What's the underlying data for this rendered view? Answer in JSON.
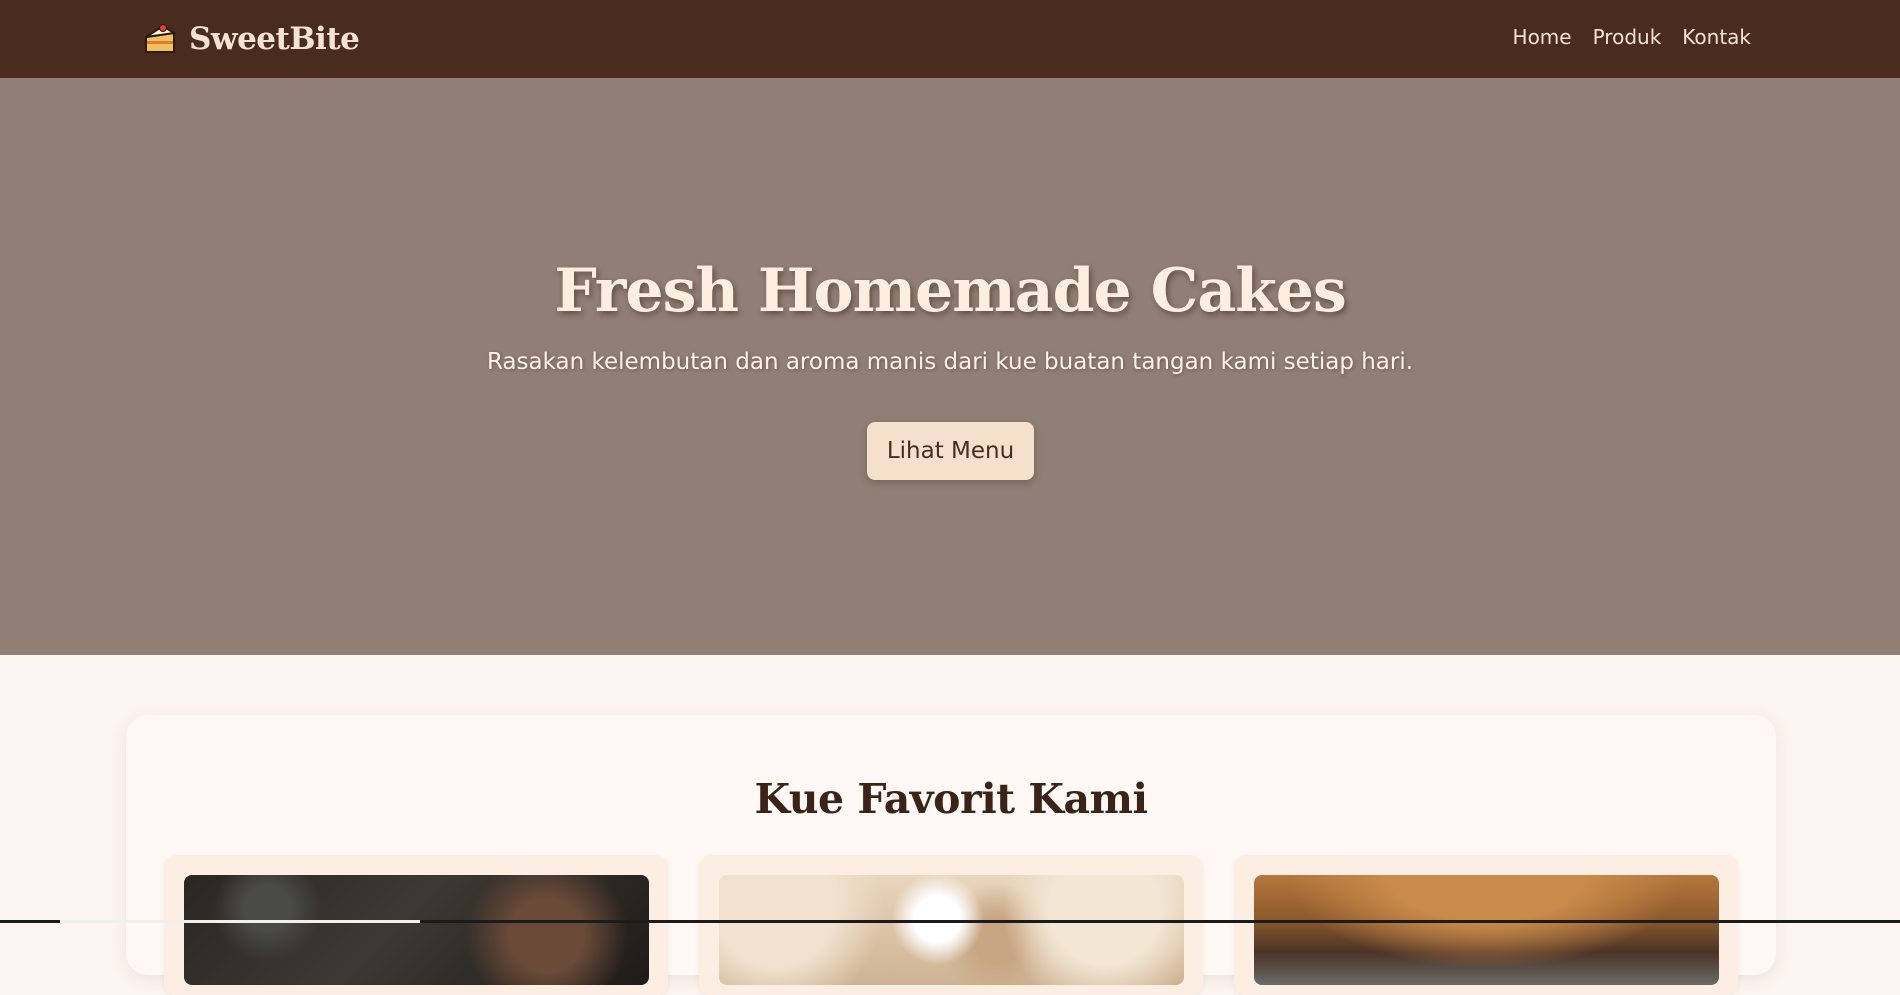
{
  "navbar": {
    "brand_icon": "cake-slice-icon",
    "brand_name": "SweetBite",
    "links": [
      {
        "label": "Home"
      },
      {
        "label": "Produk"
      },
      {
        "label": "Kontak"
      }
    ]
  },
  "hero": {
    "title": "Fresh Homemade Cakes",
    "subtitle": "Rasakan kelembutan dan aroma manis dari kue buatan tangan kami setiap hari.",
    "button_label": "Lihat Menu"
  },
  "products": {
    "title": "Kue Favorit Kami",
    "items": [
      {
        "image": "cake-photo-dark"
      },
      {
        "image": "cake-photo-cream"
      },
      {
        "image": "cake-photo-caramel"
      }
    ]
  },
  "colors": {
    "navbar_bg": "#4a2c1e",
    "hero_bg": "#917e74",
    "page_bg": "#fdf5f1",
    "accent_cream": "#f5e1cb",
    "text_dark": "#3a2418"
  }
}
